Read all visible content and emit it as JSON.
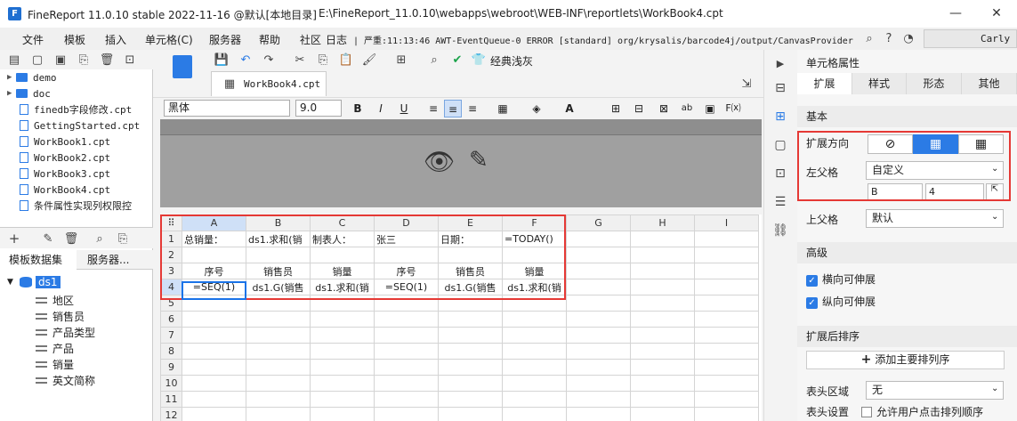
{
  "window": {
    "title": "FineReport 11.0.10 stable 2022-11-16 @默认[本地目录]",
    "path": "E:\\FineReport_11.0.10\\webapps\\webroot\\WEB-INF\\reportlets\\WorkBook4.cpt",
    "logo": "F"
  },
  "menu": [
    "文件",
    "模板",
    "插入",
    "单元格(C)",
    "服务器",
    "帮助",
    "社区",
    "日志"
  ],
  "log_line": "| 严重:11:13:46 AWT-EventQueue-0 ERROR [standard] org/krysalis/barcode4j/output/CanvasProvider",
  "user": "Carly",
  "tree": [
    {
      "kind": "folder",
      "label": "demo"
    },
    {
      "kind": "folder",
      "label": "doc"
    },
    {
      "kind": "file",
      "label": "finedb字段修改.cpt"
    },
    {
      "kind": "file",
      "label": "GettingStarted.cpt"
    },
    {
      "kind": "file",
      "label": "WorkBook1.cpt"
    },
    {
      "kind": "file",
      "label": "WorkBook2.cpt"
    },
    {
      "kind": "file",
      "label": "WorkBook3.cpt"
    },
    {
      "kind": "file",
      "label": "WorkBook4.cpt"
    },
    {
      "kind": "file",
      "label": "条件属性实现列权限控"
    }
  ],
  "ds_tabs": [
    "模板数据集",
    "服务器..."
  ],
  "dataset": {
    "name": "ds1",
    "fields": [
      "地区",
      "销售员",
      "产品类型",
      "产品",
      "销量",
      "英文简称"
    ]
  },
  "toolbar": {
    "theme_label": "经典浅灰"
  },
  "doc_tab": "WorkBook4.cpt",
  "format": {
    "font": "黑体",
    "size": "9.0"
  },
  "sheet": {
    "cols": [
      "A",
      "B",
      "C",
      "D",
      "E",
      "F",
      "G",
      "H",
      "I"
    ],
    "rows": [
      [
        "总销量：",
        "ds1.求和(销",
        "制表人：",
        "张三",
        "日期：",
        "=TODAY()",
        "",
        "",
        ""
      ],
      [
        "",
        "",
        "",
        "",
        "",
        "",
        "",
        "",
        ""
      ],
      [
        "序号",
        "销售员",
        "销量",
        "序号",
        "销售员",
        "销量",
        "",
        "",
        ""
      ],
      [
        "=SEQ(1)",
        "ds1.G(销售",
        "ds1.求和(销",
        "=SEQ(1)",
        "ds1.G(销售",
        "ds1.求和(销",
        "",
        "",
        ""
      ],
      [
        "",
        "",
        "",
        "",
        "",
        "",
        "",
        "",
        ""
      ],
      [
        "",
        "",
        "",
        "",
        "",
        "",
        "",
        "",
        ""
      ],
      [
        "",
        "",
        "",
        "",
        "",
        "",
        "",
        "",
        ""
      ],
      [
        "",
        "",
        "",
        "",
        "",
        "",
        "",
        "",
        ""
      ],
      [
        "",
        "",
        "",
        "",
        "",
        "",
        "",
        "",
        ""
      ],
      [
        "",
        "",
        "",
        "",
        "",
        "",
        "",
        "",
        ""
      ],
      [
        "",
        "",
        "",
        "",
        "",
        "",
        "",
        "",
        ""
      ],
      [
        "",
        "",
        "",
        "",
        "",
        "",
        "",
        "",
        ""
      ]
    ]
  },
  "props": {
    "title": "单元格属性",
    "tabs": [
      "扩展",
      "样式",
      "形态",
      "其他"
    ],
    "sec_basic": "基本",
    "dir_label": "扩展方向",
    "left_parent_label": "左父格",
    "left_parent_value": "自定义",
    "lp_col": "B",
    "lp_row": "4",
    "up_parent_label": "上父格",
    "up_parent_value": "默认",
    "sec_adv": "高级",
    "chk1": "横向可伸展",
    "chk2": "纵向可伸展",
    "sec_sort": "扩展后排序",
    "add_sort": "添加主要排列序",
    "header_area_label": "表头区域",
    "header_area_value": "无",
    "header_set_label": "表头设置",
    "header_set_value": "允许用户点击排列顺序"
  }
}
